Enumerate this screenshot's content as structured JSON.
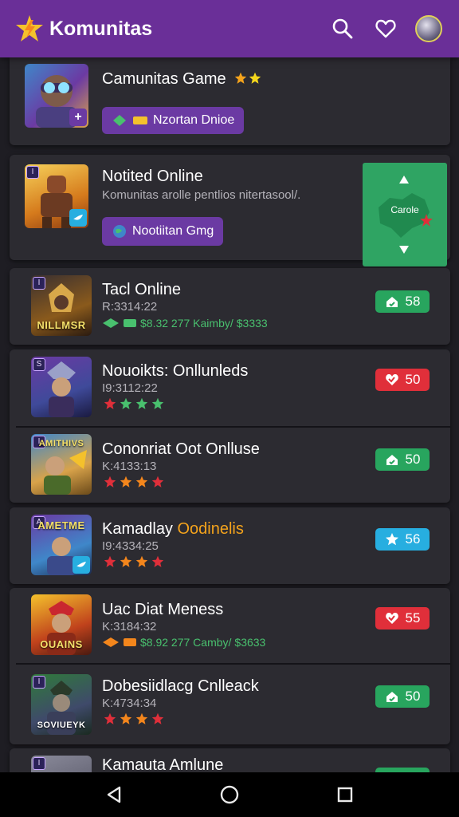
{
  "app": {
    "title": "Komunitas"
  },
  "cards": [
    {
      "title": "Camunitas Game",
      "chip": "Nzortan Dnioe"
    },
    {
      "title": "Notited Online",
      "desc": "Komunitas arolle pentlios nitertasool/.",
      "chip": "Nootiitan Gmg",
      "map_label": "Carole"
    },
    {
      "title": "Tacl Online",
      "code": "R:3314:22",
      "price_amount": "$8.32 277 Kaimby/",
      "price_extra": "$3333",
      "badge_value": "58",
      "badge_color": "#28a55e"
    },
    {
      "title": "Nouoikts: Onllunleds",
      "code": "I9:3112:22",
      "rating": 4,
      "badge_value": "50",
      "badge_color": "#e02f3a"
    },
    {
      "title": "Cononriat Oot Onlluse",
      "code": "K:4133:13",
      "rating": 4,
      "badge_value": "50",
      "badge_color": "#28a55e"
    },
    {
      "title": "Kamadlay",
      "title_highlight": "Oodinelis",
      "code": "I9:4334:25",
      "rating": 4,
      "badge_value": "56",
      "badge_color": "#27aee0"
    },
    {
      "title": "Uac Diat Meness",
      "code": "K:3184:32",
      "price_amount": "$8.92 277 Camby/",
      "price_extra": "$3633",
      "badge_value": "55",
      "badge_color": "#e02f3a"
    },
    {
      "title": "Dobesiidlacg Cnlleack",
      "code": "K:4734:34",
      "rating": 4,
      "badge_value": "50",
      "badge_color": "#28a55e"
    },
    {
      "title": "Kamauta Amlune"
    }
  ],
  "thumb_texts": [
    "NILLMSR",
    "AMITHIVS",
    "AMETME",
    "OUAINS",
    "SOVIUEYK"
  ],
  "icons": {
    "logo": "lightning-star-logo",
    "search": "search-icon",
    "notifications": "heart-icon",
    "avatar": "avatar"
  },
  "colors": {
    "appbar": "#6a2f98",
    "background": "#1e1d23",
    "card": "#2c2b31",
    "chip": "#6b3aa3",
    "green": "#28a55e",
    "red": "#e02f3a",
    "blue": "#27aee0"
  }
}
